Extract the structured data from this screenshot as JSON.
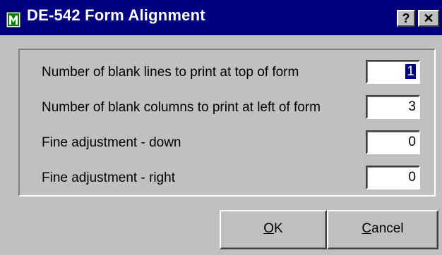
{
  "window": {
    "title": "DE-542 Form Alignment",
    "help_label": "?",
    "close_label": "✕"
  },
  "form": {
    "rows": [
      {
        "label": "Number of blank lines to print at top of form",
        "value": "1"
      },
      {
        "label": "Number of blank columns to print at left of form",
        "value": "3"
      },
      {
        "label": "Fine adjustment - down",
        "value": "0"
      },
      {
        "label": "Fine adjustment - right",
        "value": "0"
      }
    ]
  },
  "buttons": {
    "ok_mnemonic": "O",
    "ok_rest": "K",
    "cancel_mnemonic": "C",
    "cancel_rest": "ancel"
  },
  "colors": {
    "titlebar": "#000080",
    "face": "#c0c0c0",
    "selection": "#000080"
  },
  "icons": {
    "app": "form-alignment-app-icon"
  }
}
